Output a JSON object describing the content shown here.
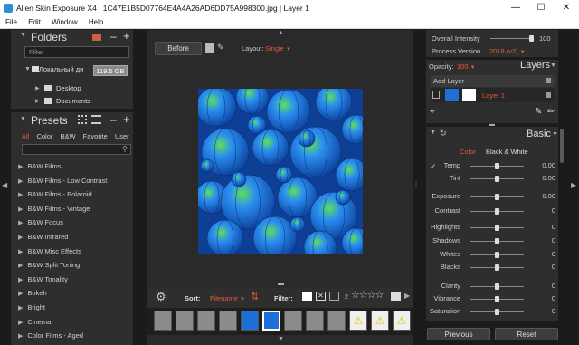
{
  "window": {
    "title": "Alien Skin Exposure X4 | 1C47E1B5D07764E4A4A26AD6DD75A998300.jpg | Layer 1"
  },
  "menu": [
    "File",
    "Edit",
    "Window",
    "Help"
  ],
  "folders": {
    "title": "Folders",
    "filter_placeholder": "Filter",
    "drive_name": "Локальный ди",
    "drive_size": "119.5 GB",
    "items": [
      "Desktop",
      "Documents"
    ]
  },
  "presets": {
    "title": "Presets",
    "tabs": [
      "All",
      "Color",
      "B&W",
      "Favorite",
      "User"
    ],
    "items": [
      "B&W Films",
      "B&W Films - Low Contrast",
      "B&W Films - Polaroid",
      "B&W Films - Vintage",
      "B&W Focus",
      "B&W Infrared",
      "B&W Misc Effects",
      "B&W Split Toning",
      "B&W Tonality",
      "Bokeh",
      "Bright",
      "Cinema",
      "Color Films - Aged"
    ]
  },
  "center": {
    "before_label": "Before",
    "layout_label": "Layout:",
    "layout_value": "Single"
  },
  "bottombar": {
    "sort_label": "Sort:",
    "sort_value": "Filename",
    "filter_label": "Filter:",
    "rating_count": "2"
  },
  "right": {
    "overall_intensity_label": "Overall Intensity",
    "overall_intensity_value": "100",
    "process_version_label": "Process Version",
    "process_version_value": "2018 (v2)",
    "opacity_label": "Opacity:",
    "opacity_value": "100",
    "layers_title": "Layers",
    "add_layer": "Add Layer",
    "layer_name": "Layer 1",
    "basic_title": "Basic",
    "color_tab": "Color",
    "bw_tab": "Black & White",
    "sliders": [
      {
        "label": "Temp",
        "value": "0.00"
      },
      {
        "label": "Tint",
        "value": "0.00"
      },
      {
        "label": "Exposure",
        "value": "0.00"
      },
      {
        "label": "Contrast",
        "value": "0"
      },
      {
        "label": "Highlights",
        "value": "0"
      },
      {
        "label": "Shadows",
        "value": "0"
      },
      {
        "label": "Whites",
        "value": "0"
      },
      {
        "label": "Blacks",
        "value": "0"
      },
      {
        "label": "Clarity",
        "value": "0"
      },
      {
        "label": "Vibrance",
        "value": "0"
      },
      {
        "label": "Saturation",
        "value": "0"
      }
    ],
    "previous_label": "Previous",
    "reset_label": "Reset"
  },
  "colors": {
    "accent": "#e8583a",
    "panel": "#2e2e2e",
    "image_blue": "#1f6fd8"
  }
}
